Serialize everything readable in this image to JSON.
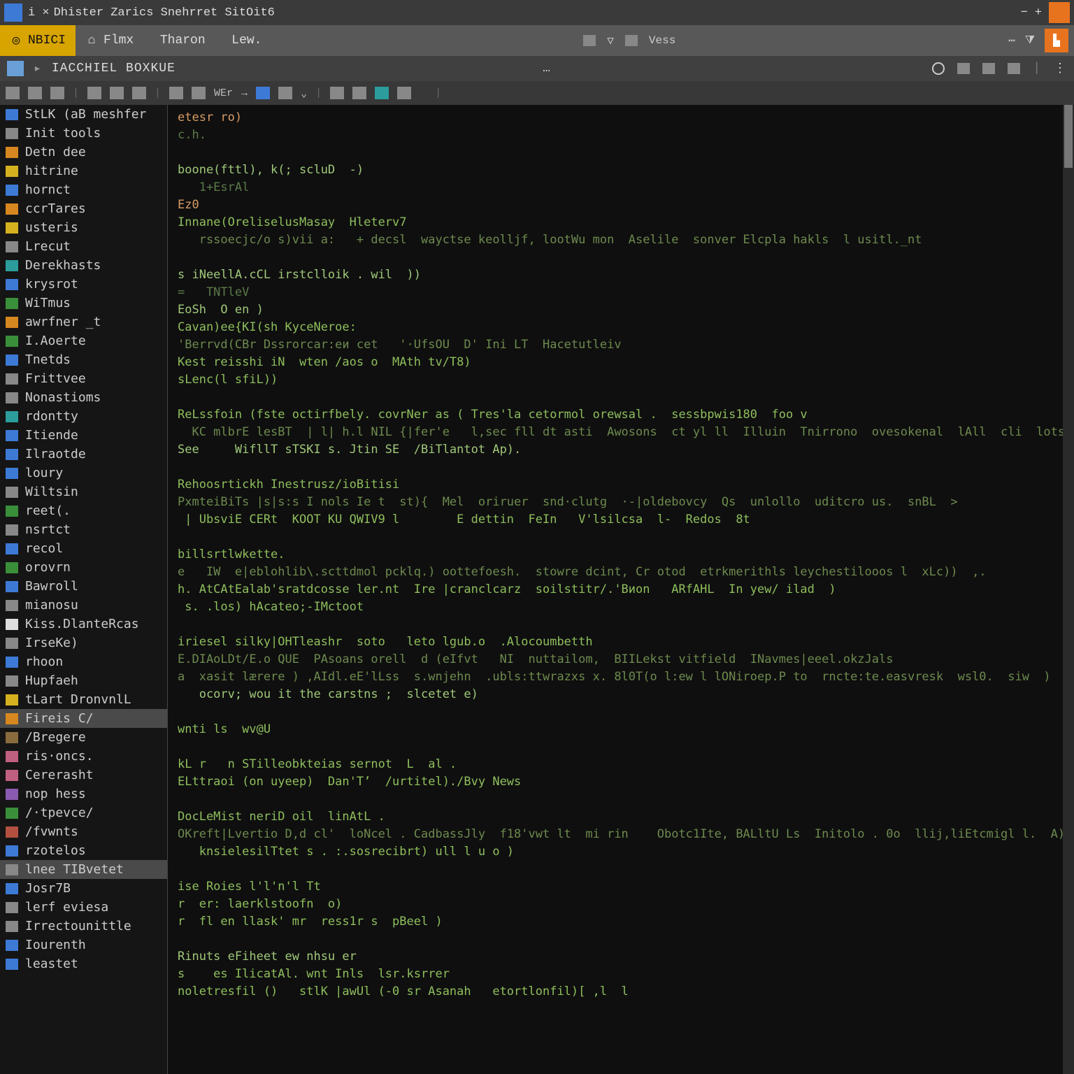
{
  "titlebar": {
    "tab_marker": "i ×",
    "title": "Dhister Zarics  Snehrret  SitOit6",
    "minimize": "−",
    "plus": "+"
  },
  "menubar": {
    "tab1": {
      "icon": "target-icon",
      "label": "NBICI"
    },
    "tab2": {
      "icon": "home-icon",
      "items": [
        "Flmx",
        "Tharon",
        "Lew."
      ]
    },
    "right": {
      "vess_label": "Vess"
    }
  },
  "pathbar": {
    "path": "IACCHIEL  BOXKUE",
    "dots": "…"
  },
  "toolbar": {
    "wer": "WEr"
  },
  "sidebar": {
    "items": [
      {
        "ico": "ico-blue",
        "label": "StLK (aB meshfer"
      },
      {
        "ico": "ico-grey",
        "label": "Init tools"
      },
      {
        "ico": "ico-orange",
        "label": "Detn dee"
      },
      {
        "ico": "ico-yellow",
        "label": "hitrine"
      },
      {
        "ico": "ico-blue",
        "label": "hornct"
      },
      {
        "ico": "ico-orange",
        "label": "ccrTares"
      },
      {
        "ico": "ico-yellow",
        "label": "usteris"
      },
      {
        "ico": "ico-grey",
        "label": "Lrecut"
      },
      {
        "ico": "ico-teal",
        "label": "Derekhasts"
      },
      {
        "ico": "ico-blue",
        "label": "krysrot"
      },
      {
        "ico": "ico-green",
        "label": "WiTmus"
      },
      {
        "ico": "ico-orange",
        "label": "awrfner _t"
      },
      {
        "ico": "ico-green",
        "label": "I.Aoerte"
      },
      {
        "ico": "ico-blue",
        "label": "Tnetds"
      },
      {
        "ico": "ico-grey",
        "label": "Frittvee"
      },
      {
        "ico": "ico-grey",
        "label": "Nonastioms"
      },
      {
        "ico": "ico-teal",
        "label": "rdontty"
      },
      {
        "ico": "ico-blue",
        "label": "Itiende"
      },
      {
        "ico": "ico-blue",
        "label": "Ilraotde"
      },
      {
        "ico": "ico-blue",
        "label": "loury"
      },
      {
        "ico": "ico-grey",
        "label": "Wiltsin"
      },
      {
        "ico": "ico-green",
        "label": "reet(."
      },
      {
        "ico": "ico-grey",
        "label": "nsrtct"
      },
      {
        "ico": "ico-blue",
        "label": "recol"
      },
      {
        "ico": "ico-green",
        "label": "orovrn"
      },
      {
        "ico": "ico-blue",
        "label": "Bawroll"
      },
      {
        "ico": "ico-grey",
        "label": "mianosu"
      },
      {
        "ico": "ico-white",
        "label": "Kiss.DlanteRcas"
      },
      {
        "ico": "ico-grey",
        "label": "IrseKe)"
      },
      {
        "ico": "ico-blue",
        "label": "rhoon"
      },
      {
        "ico": "ico-grey",
        "label": "Hupfaeh"
      },
      {
        "ico": "ico-yellow",
        "label": "tLart DronvnlL"
      },
      {
        "ico": "ico-orange",
        "label": "Fireis C/",
        "sel": true
      },
      {
        "ico": "ico-brown",
        "label": "/Bregere"
      },
      {
        "ico": "ico-pink",
        "label": "ris·oncs."
      },
      {
        "ico": "ico-pink",
        "label": "Cererasht"
      },
      {
        "ico": "ico-purple",
        "label": "nop hess"
      },
      {
        "ico": "ico-green",
        "label": "/·tpevce/"
      },
      {
        "ico": "ico-red",
        "label": "/fvwnts"
      },
      {
        "ico": "ico-blue",
        "label": "rzotelos"
      },
      {
        "ico": "ico-grey",
        "label": "lnee TIBvetet",
        "sel": true
      },
      {
        "ico": "ico-blue",
        "label": "Josr7B"
      },
      {
        "ico": "ico-grey",
        "label": "lerf eviesa"
      },
      {
        "ico": "ico-grey",
        "label": "Irrectounittle"
      },
      {
        "ico": "ico-blue",
        "label": "Iourenth"
      },
      {
        "ico": "ico-blue",
        "label": "leastet"
      }
    ]
  },
  "editor": {
    "lines": [
      {
        "cls": "tok-kw",
        "text": "etesr ro)"
      },
      {
        "cls": "tok-cm",
        "text": "c.h."
      },
      {
        "cls": "tok-plain",
        "text": ""
      },
      {
        "cls": "tok-fn",
        "text": "boone(fttl), k(; scluD  -)"
      },
      {
        "cls": "tok-cm",
        "text": "   1+EsrAl"
      },
      {
        "cls": "tok-kw",
        "text": "Ez0"
      },
      {
        "cls": "tok-id",
        "text": "Innane(OreliselusMasay  Hleterv7"
      },
      {
        "cls": "tok-str",
        "text": "   rssoecjc/o s)vii a:   + decsl  wayctse keolljf, lootWu mon  Aselile  sonver Elcpla hakls  l usitl._nt"
      },
      {
        "cls": "tok-plain",
        "text": ""
      },
      {
        "cls": "tok-fn",
        "text": "s iNeellA.cCL irstclloik . wil  ))"
      },
      {
        "cls": "tok-cm",
        "text": "=   TNTleV"
      },
      {
        "cls": "tok-fn",
        "text": "EoSh  O en )"
      },
      {
        "cls": "tok-id",
        "text": "Cavan)ee{KI(sh KyceNeroe:"
      },
      {
        "cls": "tok-str",
        "text": "'Berrvd(CBr Dssrorcar:eи cet   '·UfsOU  D' Ini LT  Hacetutleiv"
      },
      {
        "cls": "tok-id",
        "text": "Kest reisshi iN  wten /aos o  MAth tv/T8)"
      },
      {
        "cls": "tok-id",
        "text": "sLenc(l sfiL))"
      },
      {
        "cls": "tok-plain",
        "text": ""
      },
      {
        "cls": "tok-id",
        "text": "ReLssfoin (fste octirfbely. covrNer as ( Tres'la cetormol orewsal .  sessbpwis180  foo v"
      },
      {
        "cls": "tok-str",
        "text": "  KC mlbrE lesBT  | l| h.l NIL {|fer'e   l,sec fll dt asti  Awosons  ct yl ll  Illuin  Tnirrono  ovesokenal  lAll  cli  lots"
      },
      {
        "cls": "tok-fn",
        "text": "See     WifllT sTSKI s. Jtin SE  /BiTlantot Ap)."
      },
      {
        "cls": "tok-plain",
        "text": ""
      },
      {
        "cls": "tok-id",
        "text": "Rehoosrtickh Inestrusz/ioBitisi"
      },
      {
        "cls": "tok-str",
        "text": "PxmteiBiTs |s|s:s I nols Ie t  st){  Mel  oriruer  snd·clutg  ·-|oldebovcy  Qs  unlollo  uditcro us.  snBL  >"
      },
      {
        "cls": "tok-id",
        "text": " | UbsviE CERt  KOOT KU QWIV9 l        E dettin  FeIn   V'lsilcsa  l-  Redos  8t"
      },
      {
        "cls": "tok-plain",
        "text": ""
      },
      {
        "cls": "tok-id",
        "text": "billsrtlwkette."
      },
      {
        "cls": "tok-str",
        "text": "e   IW  e|eblohlib\\.scttdmol pcklq.) oottefoesh.  stowre dcint, Cr otod  etrkmerithls leychestilooos l  xLc))  ,."
      },
      {
        "cls": "tok-id",
        "text": "h. AtCAtEalab'sratdcosse ler.nt  Ire |cranclcarz  soilstitr/.'Bиon   ARfAHL  In yew/ ilad  )"
      },
      {
        "cls": "tok-id",
        "text": " s. .los) hAcateo;-IMctoot"
      },
      {
        "cls": "tok-plain",
        "text": ""
      },
      {
        "cls": "tok-id",
        "text": "iriesel silky|OHTleashr  soto   leto lgub.o  .Alocoumbetth"
      },
      {
        "cls": "tok-str",
        "text": "E.DIAoLDt/E.o QUE  PAsoans orell  d (eIfvt   NI  nuttailom,  BIILekst vitfield  INavmes|eeel.okzJals"
      },
      {
        "cls": "tok-str",
        "text": "a  xasit lærere ) ,AIdl.eE'lLss  s.wnjehn  .ubls:ttwrazxs x. 8l0T(o l:ew l lONiroep.P to  rncte:te.easvresk  wsl0.  siw  )"
      },
      {
        "cls": "tok-fn",
        "text": "   ocorv; wou it the carstns ;  slcetet e)"
      },
      {
        "cls": "tok-plain",
        "text": ""
      },
      {
        "cls": "tok-id",
        "text": "wnti ls  wv@U"
      },
      {
        "cls": "tok-plain",
        "text": ""
      },
      {
        "cls": "tok-id",
        "text": "kL r   n STilleobkteias sernot  L  al ."
      },
      {
        "cls": "tok-id",
        "text": "ELttraoi (on uyeep)  Dan'Tʼ  /urtitel)./Bvy News"
      },
      {
        "cls": "tok-plain",
        "text": ""
      },
      {
        "cls": "tok-id",
        "text": "DocLeMist neriD oil  linAtL ."
      },
      {
        "cls": "tok-str",
        "text": "OKreft|Lvertio D,d cl'  loNcel . CadbassJly  f18'vwt lt  mi rin    Obotc1Ite, BALltU Ls  Initolo . 0o  llij,liEtcmigl l.  A))."
      },
      {
        "cls": "tok-id",
        "text": "   knsielesilTtet s . :.sosrecibrt) ull l u o )"
      },
      {
        "cls": "tok-plain",
        "text": ""
      },
      {
        "cls": "tok-id",
        "text": "ise Roies l'l'n'l Tt"
      },
      {
        "cls": "tok-id",
        "text": "r  er: laerklstoofn  o)"
      },
      {
        "cls": "tok-id",
        "text": "r  fl en llask' mr  ress1r s  pBeel )"
      },
      {
        "cls": "tok-plain",
        "text": ""
      },
      {
        "cls": "tok-fn",
        "text": "Rinuts eFiheet ew nhsu er"
      },
      {
        "cls": "tok-id",
        "text": "s    es IlicatAl. wnt Inls  lsr.ksrrer"
      },
      {
        "cls": "tok-id",
        "text": "noletresfil ()   stlK |awUl (-0 sr Asanah   etortlonfil)[ ,l  l"
      }
    ]
  }
}
